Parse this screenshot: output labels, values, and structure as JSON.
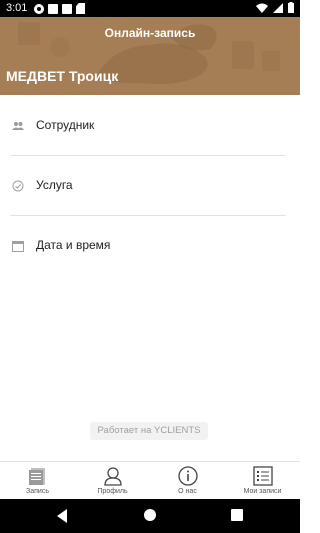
{
  "status_bar": {
    "time": "3:01",
    "left_icons": [
      "square-icon",
      "gear-icon",
      "square-icon",
      "square-icon",
      "sd-card-icon"
    ],
    "right_icons": [
      "wifi-icon",
      "signal-icon",
      "battery-icon"
    ]
  },
  "header": {
    "title": "Онлайн-запись",
    "clinic_name": "МЕДВЕТ Троицк",
    "background_color": "#a57e55"
  },
  "menu": {
    "items": [
      {
        "label": "Сотрудник",
        "icon": "staff-icon"
      },
      {
        "label": "Услуга",
        "icon": "check-circle-icon"
      },
      {
        "label": "Дата и время",
        "icon": "calendar-icon"
      }
    ]
  },
  "powered_by": "Работает на YCLIENTS",
  "bottom_nav": {
    "items": [
      {
        "label": "Запись",
        "icon": "document-icon"
      },
      {
        "label": "Профиль",
        "icon": "person-icon"
      },
      {
        "label": "О нас",
        "icon": "info-icon"
      },
      {
        "label": "Мои записи",
        "icon": "list-icon"
      }
    ]
  },
  "android_nav": [
    "back-icon",
    "home-icon",
    "recent-apps-icon"
  ]
}
